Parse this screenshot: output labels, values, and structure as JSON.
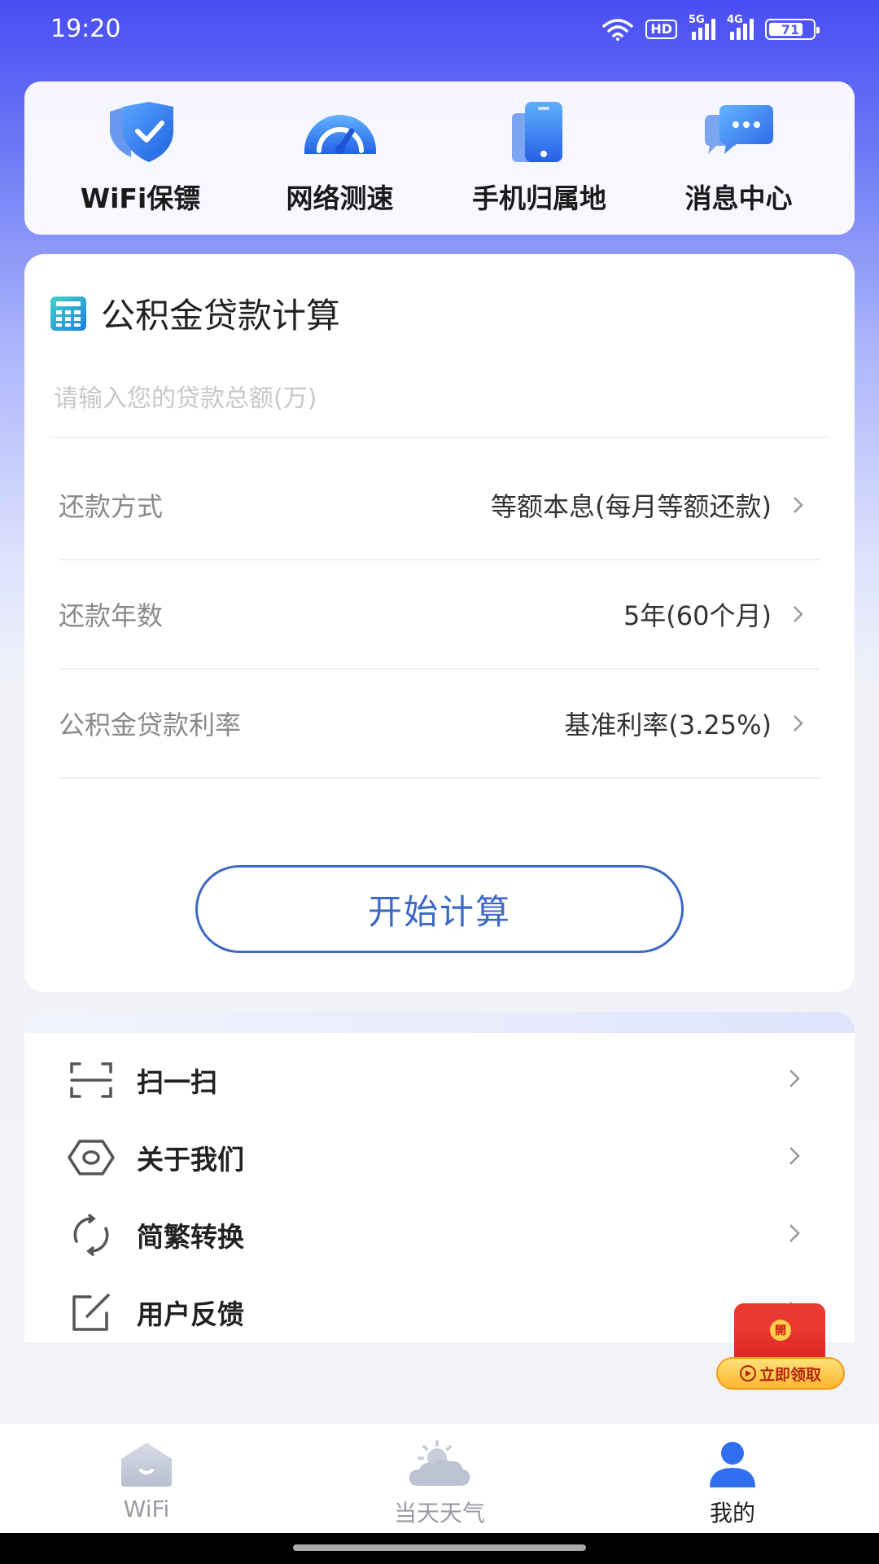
{
  "status_bar": {
    "time": "19:20",
    "hd_label": "HD",
    "signal_1_label": "5G",
    "signal_2_label": "4G",
    "battery": "71"
  },
  "quick_tools": [
    {
      "label": "WiFi保镖",
      "icon": "shield-check-icon"
    },
    {
      "label": "网络测速",
      "icon": "speedometer-icon"
    },
    {
      "label": "手机归属地",
      "icon": "phone-icon"
    },
    {
      "label": "消息中心",
      "icon": "chat-bubbles-icon"
    }
  ],
  "calculator": {
    "title": "公积金贷款计算",
    "amount_placeholder": "请输入您的贷款总额(万)",
    "amount_value": "",
    "rows": [
      {
        "label": "还款方式",
        "value": "等额本息(每月等额还款)"
      },
      {
        "label": "还款年数",
        "value": "5年(60个月)"
      },
      {
        "label": "公积金贷款利率",
        "value": "基准利率(3.25%)"
      }
    ],
    "button_label": "开始计算"
  },
  "menu": [
    {
      "label": "扫一扫",
      "icon": "scan-icon"
    },
    {
      "label": "关于我们",
      "icon": "hexagon-eye-icon"
    },
    {
      "label": "简繁转换",
      "icon": "refresh-icon"
    },
    {
      "label": "用户反馈",
      "icon": "edit-icon"
    }
  ],
  "red_packet": {
    "seal": "開",
    "label": "立即领取"
  },
  "bottom_nav": {
    "tabs": [
      {
        "label": "WiFi",
        "icon": "home-icon",
        "active": false
      },
      {
        "label": "当天天气",
        "icon": "weather-icon",
        "active": false
      },
      {
        "label": "我的",
        "icon": "user-icon",
        "active": true
      }
    ]
  },
  "colors": {
    "accent": "#3c68c6",
    "header_gradient_top": "#4a4cf3",
    "red_packet": "#e83a30",
    "nav_active": "#2f6ff0"
  }
}
